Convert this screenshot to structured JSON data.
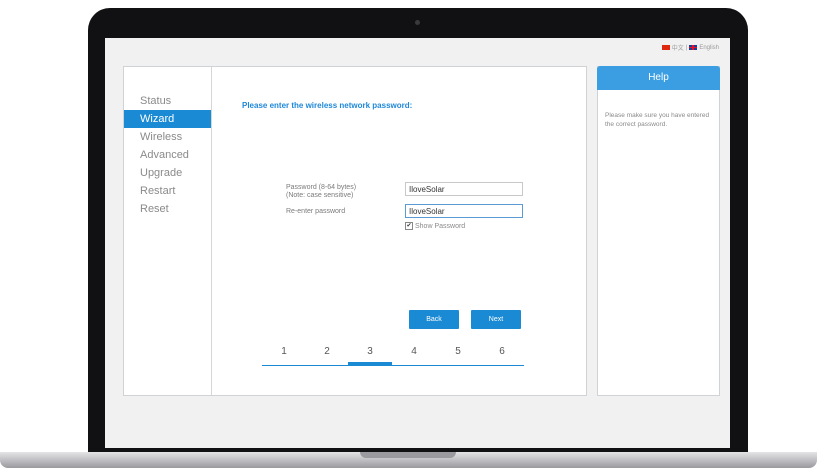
{
  "language_bar": {
    "chinese_label": "中文",
    "separator": "|",
    "english_label": "English"
  },
  "nav": {
    "items": [
      {
        "label": "Status"
      },
      {
        "label": "Wizard",
        "active": true
      },
      {
        "label": "Wireless"
      },
      {
        "label": "Advanced"
      },
      {
        "label": "Upgrade"
      },
      {
        "label": "Restart"
      },
      {
        "label": "Reset"
      }
    ]
  },
  "main": {
    "title": "Please enter the wireless network password:",
    "password_label_line1": "Password (8-64 bytes)",
    "password_label_line2": "(Note: case sensitive)",
    "reenter_label": "Re-enter password",
    "password_value": "IloveSolar",
    "reenter_value": "IloveSolar",
    "show_password_label": "Show Password",
    "show_password_checked": true,
    "back_label": "Back",
    "next_label": "Next"
  },
  "steps": {
    "items": [
      "1",
      "2",
      "3",
      "4",
      "5",
      "6"
    ],
    "current": "3"
  },
  "help": {
    "title": "Help",
    "text": "Please make sure you have entered the correct password."
  },
  "colors": {
    "accent": "#1a8ad4",
    "help_header": "#3c9ee2",
    "title_text": "#1f88d8"
  }
}
